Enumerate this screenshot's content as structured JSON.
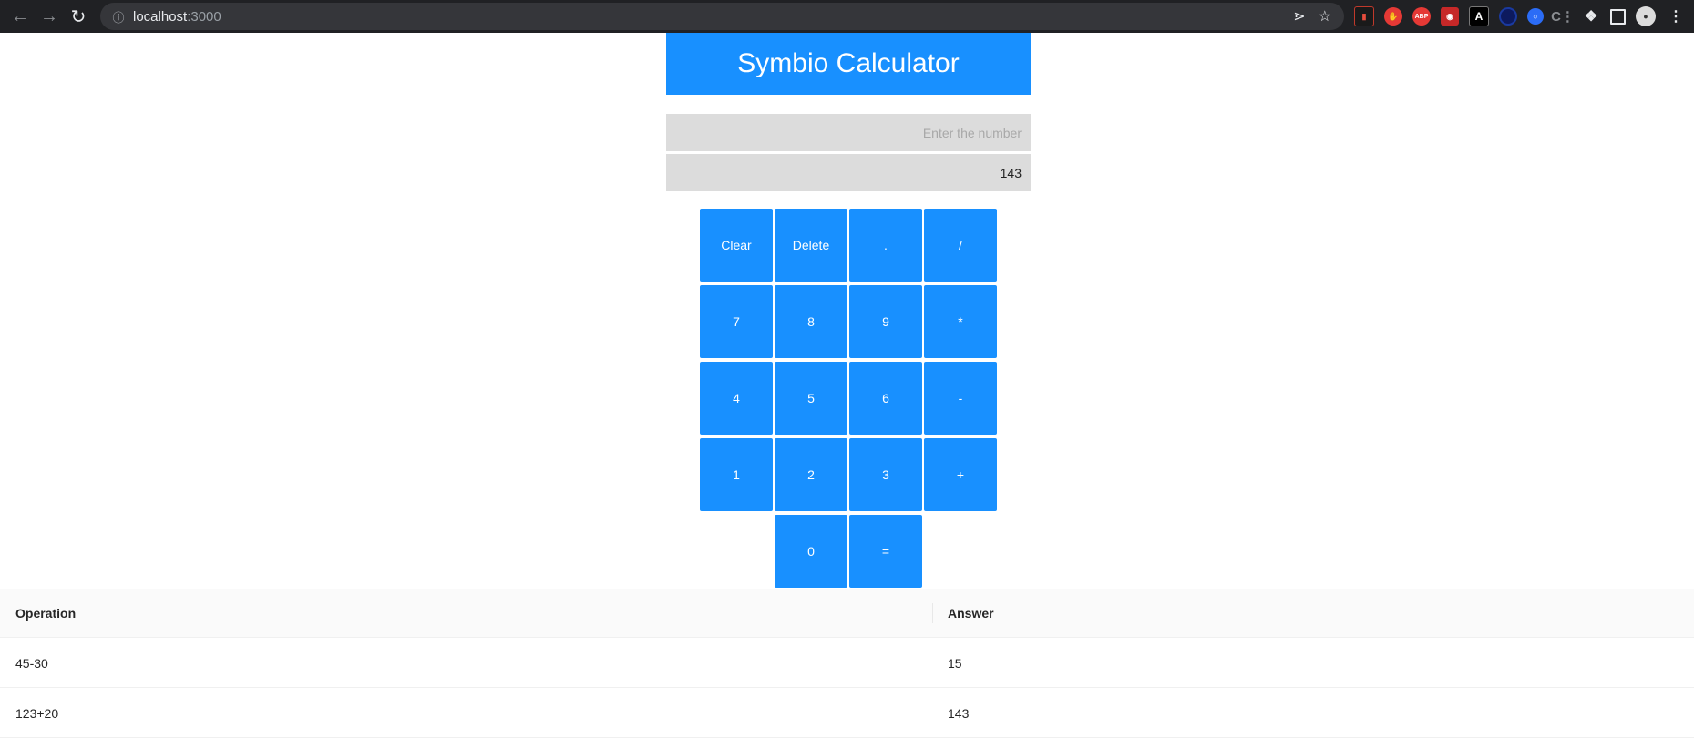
{
  "browser": {
    "url_host": "localhost",
    "url_port": ":3000",
    "extensions_abp_label": "ABP",
    "extensions_a_label": "A"
  },
  "app": {
    "title": "Symbio Calculator",
    "input_placeholder": "Enter the number",
    "result_value": "143"
  },
  "keys": {
    "clear": "Clear",
    "delete": "Delete",
    "dot": ".",
    "divide": "/",
    "seven": "7",
    "eight": "8",
    "nine": "9",
    "multiply": "*",
    "four": "4",
    "five": "5",
    "six": "6",
    "minus": "-",
    "one": "1",
    "two": "2",
    "three": "3",
    "plus": "+",
    "zero": "0",
    "equals": "="
  },
  "history": {
    "columns": [
      "Operation",
      "Answer"
    ],
    "rows": [
      {
        "operation": "45-30",
        "answer": "15"
      },
      {
        "operation": "123+20",
        "answer": "143"
      }
    ]
  },
  "colors": {
    "accent": "#1890ff",
    "field_bg": "#dcdcdc",
    "chrome_bg": "#202124"
  }
}
